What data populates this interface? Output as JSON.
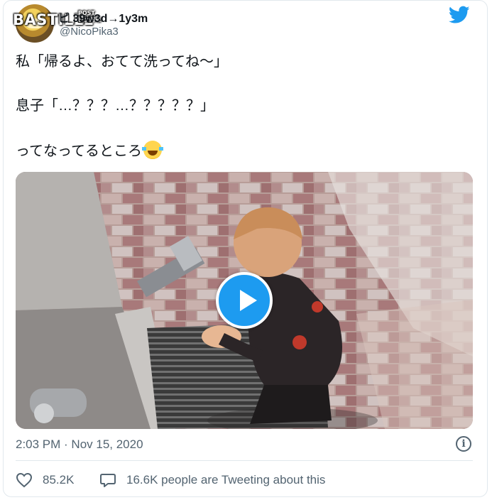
{
  "watermark": {
    "brand": "BASTILLE",
    "sub": "POST\n巴士的報"
  },
  "header": {
    "display_name": "ピ 39w3d→1y3m",
    "handle": "@NicoPika3",
    "logo_icon": "twitter-bird-icon"
  },
  "tweet": {
    "line1": "私「帰るよ、おてて洗ってね〜」",
    "line2": "息子「…？？？…？？？？？」",
    "line3": "ってなってるところ",
    "emoji_icon": "face-with-tears-of-joy-icon"
  },
  "media": {
    "type": "video",
    "play_icon": "play-icon"
  },
  "meta": {
    "timestamp": "2:03 PM · Nov 15, 2020",
    "info_icon": "info-icon"
  },
  "actions": {
    "likes": "85.2K",
    "like_icon": "heart-icon",
    "replies_text": "16.6K people are Tweeting about this",
    "reply_icon": "speech-bubble-icon"
  },
  "colors": {
    "accent": "#1d9bf0",
    "secondary_text": "#536471",
    "border": "#e1e8ed"
  }
}
